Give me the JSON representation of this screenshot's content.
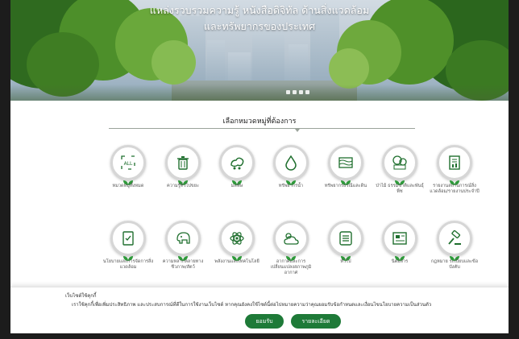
{
  "hero": {
    "title": "แหล่งรวบรวมความรู้ หนังสือดิจิทัล ด้านสิ่งแวดล้อม",
    "subtitle": "และทรัพยากรของประเทศ",
    "slide_count": 4
  },
  "section": {
    "title": "เลือกหมวดหมู่ที่ต้องการ"
  },
  "categories": [
    {
      "label": "หมวดหมู่ทั้งหมด",
      "icon": "all-icon"
    },
    {
      "label": "ความรู้ทั่วไปขยะ",
      "icon": "trash-bin-icon"
    },
    {
      "label": "มลพิษ",
      "icon": "pollution-icon"
    },
    {
      "label": "ทรัพยากรน้ำ",
      "icon": "water-drop-icon"
    },
    {
      "label": "ทรัพยากรธรณีและดิน",
      "icon": "soil-layers-icon"
    },
    {
      "label": "ป่าไม้ ธรรมชาติและพันธุ์พืช",
      "icon": "forest-icon"
    },
    {
      "label": "รายงานสถานการณ์สิ่งแวดล้อม/รายงานประจำปี",
      "icon": "report-icon"
    },
    {
      "label": "นโยบายและการจัดการสิ่งแวดล้อม",
      "icon": "policy-document-icon"
    },
    {
      "label": "ความหลากหลายทางชีวภาพ/สัตว์",
      "icon": "elephant-icon"
    },
    {
      "label": "พลังงานและเทคโนโลยี",
      "icon": "atom-icon"
    },
    {
      "label": "อากาศและการเปลี่ยนแปลงสภาพภูมิอากาศ",
      "icon": "weather-icon"
    },
    {
      "label": "ทั่วไป",
      "icon": "list-icon"
    },
    {
      "label": "นิตยสาร",
      "icon": "magazine-icon"
    },
    {
      "label": "กฎหมาย ระเบียบและข้อบังคับ",
      "icon": "gavel-icon"
    }
  ],
  "cookie": {
    "title": "เว็บไซต์ใช้คุกกี้",
    "text": "เราใช้คุกกี้เพื่อเพิ่มประสิทธิภาพ และประสบการณ์ที่ดีในการใช้งานเว็บไซต์ หากคุณยังคงใช้ไซต์นี้ต่อไปหมายความว่าคุณยอมรับข้อกำหนดและเงื่อนไขนโยบายความเป็นส่วนตัว",
    "accept_label": "ยอมรับ",
    "details_label": "รายละเอียด"
  },
  "colors": {
    "accent_green": "#1e7a38",
    "leaf_green": "#2e9a3a"
  }
}
